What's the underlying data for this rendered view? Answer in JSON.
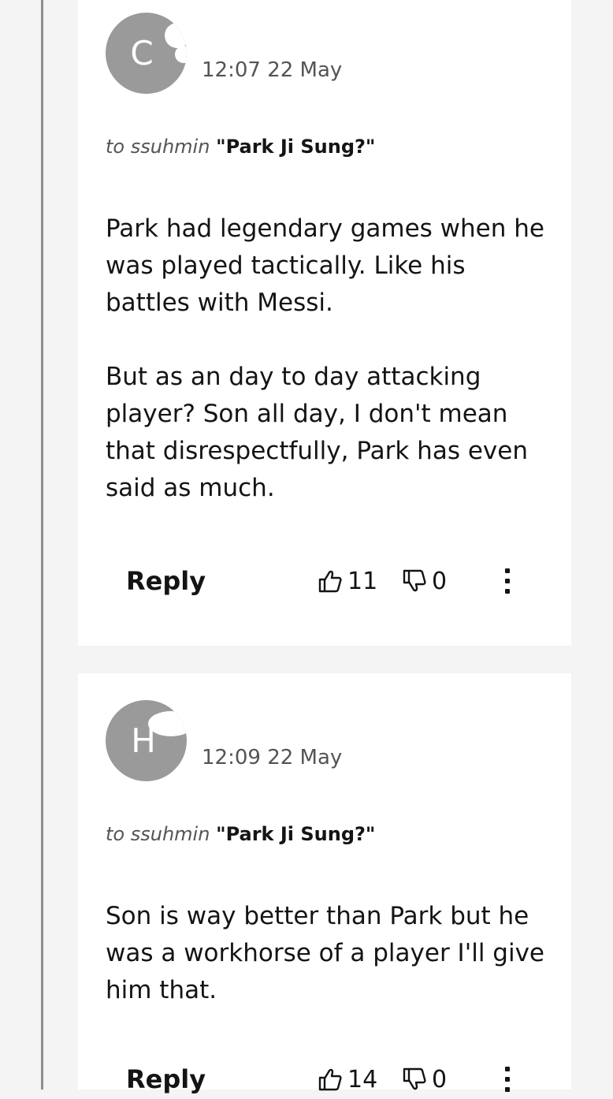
{
  "comments": [
    {
      "avatar_letter": "C",
      "timestamp": "12:07 22 May",
      "reply_prefix": "to ssuhmin",
      "reply_quote": "\"Park Ji Sung?\"",
      "paragraphs": [
        "Park had legendary games when he was played tactically.  Like his battles with Messi.",
        "But as an day to day attacking player?  Son all day, I don't mean that disrespectfully, Park has even said as much."
      ],
      "reply_label": "Reply",
      "likes": "11",
      "dislikes": "0"
    },
    {
      "avatar_letter": "H",
      "timestamp": "12:09 22 May",
      "reply_prefix": "to ssuhmin",
      "reply_quote": "\"Park Ji Sung?\"",
      "paragraphs": [
        "Son is way better than Park but he was a workhorse of a player I'll give him that."
      ],
      "reply_label": "Reply",
      "likes": "14",
      "dislikes": "0"
    }
  ],
  "icons": {
    "like": "thumbs-up-icon",
    "dislike": "thumbs-down-icon",
    "more": "more-options-icon"
  },
  "colors": {
    "avatar": "#9a9a9a",
    "page_background": "#f4f4f4",
    "card_background": "#ffffff",
    "text_primary": "#141414",
    "text_secondary": "#545454"
  }
}
